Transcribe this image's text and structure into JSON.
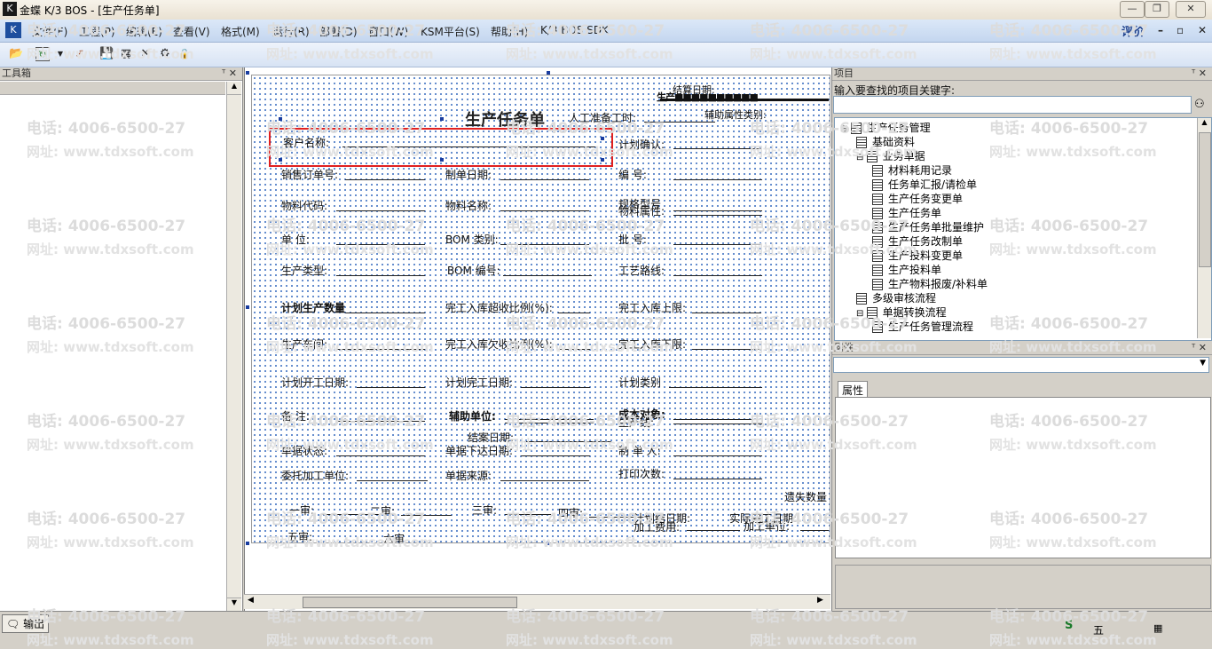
{
  "window": {
    "title": "金蝶 K/3 BOS - [生产任务单]"
  },
  "menu": {
    "items": [
      "文件(F)",
      "工程(P)",
      "编辑(E)",
      "查看(V)",
      "格式(M)",
      "运行(R)",
      "部署(D)",
      "窗口(W)",
      "KSM平台(S)",
      "帮助(H)",
      "K/3 BOS SDK"
    ],
    "rate": "评价"
  },
  "toolbox": {
    "title": "工具箱"
  },
  "form": {
    "title": "生产任务单",
    "rengong": "人工准备工时:",
    "fields": {
      "customer": "客户名称:",
      "plan_confirm": "计划确认:",
      "sales_order": "销售订单号:",
      "made_date": "制单日期:",
      "code_no": "编    号:",
      "material_code": "物料代码:",
      "material_name": "物料名称:",
      "spec": "规格型号",
      "material_attr": "物料属性:",
      "unit": "单    位:",
      "bom_type": "BOM 类别:",
      "batch": "批    号:",
      "prod_type": "生产类型:",
      "bom_no": "BOM 编号:",
      "route": "工艺路线:",
      "plan_qty": "计划生产数量",
      "over_ratio": "完工入库超收比例(%):",
      "upper": "完工入库上限:",
      "workshop": "生产车间:",
      "under_ratio": "完工入库欠收比例(%):",
      "lower": "完工入库下限:",
      "start_date": "计划开工日期:",
      "finish_date": "计划完工日期:",
      "plan_cat": "计划类别",
      "remark": "备    注:",
      "aux_unit": "辅助单位:",
      "cost_obj": "成本对象:",
      "line": "生产线:",
      "close_date": "结案日期:",
      "status": "单据状态:",
      "issue_date": "单据下达日期:",
      "maker": "制 单 人:",
      "outsource": "委托加工单位:",
      "source": "单据来源:",
      "print_count": "打印次数:",
      "loss_qty": "遗失数量",
      "aud1": "一审:",
      "aud2": "二审:",
      "aud3": "三审:",
      "aud4": "四审:",
      "aud5": "五审:",
      "aud6": "六审",
      "plan_close": "计划结日期:",
      "actual_finish": "实际完工日期:",
      "proc_cost": "加工费用:",
      "proc_unit": "加工单位:",
      "top1": "结算日期:",
      "top2": "辅助属性类别:"
    }
  },
  "project": {
    "title": "项目",
    "search_label": "输入要查找的项目关键字:",
    "tree": [
      {
        "label": "生产任务管理",
        "level": 0
      },
      {
        "label": "基础资料",
        "level": 1
      },
      {
        "label": "业务单据",
        "level": 1
      },
      {
        "label": "材料耗用记录",
        "level": 2
      },
      {
        "label": "任务单汇报/请检单",
        "level": 2
      },
      {
        "label": "生产任务变更单",
        "level": 2
      },
      {
        "label": "生产任务单",
        "level": 2
      },
      {
        "label": "生产任务单批量维护",
        "level": 2
      },
      {
        "label": "生产任务改制单",
        "level": 2
      },
      {
        "label": "生产投料变更单",
        "level": 2
      },
      {
        "label": "生产投料单",
        "level": 2
      },
      {
        "label": "生产物料报废/补料单",
        "level": 2
      },
      {
        "label": "多级审核流程",
        "level": 1
      },
      {
        "label": "单据转换流程",
        "level": 1
      },
      {
        "label": "生产任务管理流程",
        "level": 2
      }
    ]
  },
  "properties": {
    "title": "属性",
    "tab": "属性"
  },
  "status": {
    "output_tab": "输出"
  },
  "watermark": {
    "phone": "电话: 4006-6500-27",
    "site": "网址: www.tdxsoft.com"
  }
}
